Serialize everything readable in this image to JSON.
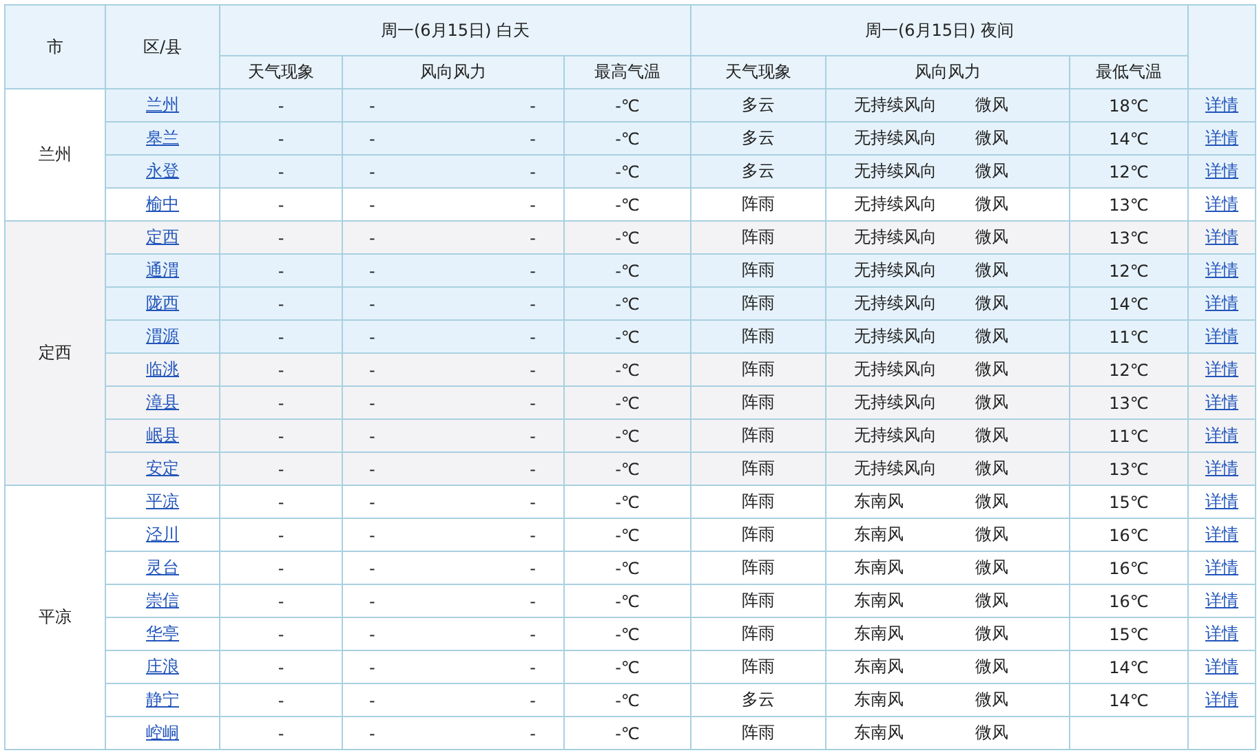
{
  "header": {
    "city": "市",
    "district": "区/县",
    "day_title": "周一(6月15日) 白天",
    "night_title": "周一(6月15日) 夜间",
    "day_columns": [
      "天气现象",
      "风向风力",
      "最高气温"
    ],
    "night_columns": [
      "天气现象",
      "风向风力",
      "最低气温"
    ]
  },
  "cities": [
    {
      "name": "兰州",
      "shaded": false,
      "rows": [
        {
          "district": "兰州",
          "highlighted": true,
          "day_weather": "-",
          "day_wind_direction": "-",
          "day_wind_force": "-",
          "day_high": "-℃",
          "night_weather": "多云",
          "night_wind_direction": "无持续风向",
          "night_wind_force": "微风",
          "night_low": "18℃",
          "details": "详情"
        },
        {
          "district": "皋兰",
          "highlighted": true,
          "day_weather": "-",
          "day_wind_direction": "-",
          "day_wind_force": "-",
          "day_high": "-℃",
          "night_weather": "多云",
          "night_wind_direction": "无持续风向",
          "night_wind_force": "微风",
          "night_low": "14℃",
          "details": "详情"
        },
        {
          "district": "永登",
          "highlighted": true,
          "day_weather": "-",
          "day_wind_direction": "-",
          "day_wind_force": "-",
          "day_high": "-℃",
          "night_weather": "多云",
          "night_wind_direction": "无持续风向",
          "night_wind_force": "微风",
          "night_low": "12℃",
          "details": "详情"
        },
        {
          "district": "榆中",
          "highlighted": false,
          "day_weather": "-",
          "day_wind_direction": "-",
          "day_wind_force": "-",
          "day_high": "-℃",
          "night_weather": "阵雨",
          "night_wind_direction": "无持续风向",
          "night_wind_force": "微风",
          "night_low": "13℃",
          "details": "详情"
        }
      ]
    },
    {
      "name": "定西",
      "shaded": true,
      "rows": [
        {
          "district": "定西",
          "highlighted": false,
          "day_weather": "-",
          "day_wind_direction": "-",
          "day_wind_force": "-",
          "day_high": "-℃",
          "night_weather": "阵雨",
          "night_wind_direction": "无持续风向",
          "night_wind_force": "微风",
          "night_low": "13℃",
          "details": "详情"
        },
        {
          "district": "通渭",
          "highlighted": true,
          "day_weather": "-",
          "day_wind_direction": "-",
          "day_wind_force": "-",
          "day_high": "-℃",
          "night_weather": "阵雨",
          "night_wind_direction": "无持续风向",
          "night_wind_force": "微风",
          "night_low": "12℃",
          "details": "详情"
        },
        {
          "district": "陇西",
          "highlighted": true,
          "day_weather": "-",
          "day_wind_direction": "-",
          "day_wind_force": "-",
          "day_high": "-℃",
          "night_weather": "阵雨",
          "night_wind_direction": "无持续风向",
          "night_wind_force": "微风",
          "night_low": "14℃",
          "details": "详情"
        },
        {
          "district": "渭源",
          "highlighted": true,
          "day_weather": "-",
          "day_wind_direction": "-",
          "day_wind_force": "-",
          "day_high": "-℃",
          "night_weather": "阵雨",
          "night_wind_direction": "无持续风向",
          "night_wind_force": "微风",
          "night_low": "11℃",
          "details": "详情"
        },
        {
          "district": "临洮",
          "highlighted": false,
          "day_weather": "-",
          "day_wind_direction": "-",
          "day_wind_force": "-",
          "day_high": "-℃",
          "night_weather": "阵雨",
          "night_wind_direction": "无持续风向",
          "night_wind_force": "微风",
          "night_low": "12℃",
          "details": "详情"
        },
        {
          "district": "漳县",
          "highlighted": false,
          "day_weather": "-",
          "day_wind_direction": "-",
          "day_wind_force": "-",
          "day_high": "-℃",
          "night_weather": "阵雨",
          "night_wind_direction": "无持续风向",
          "night_wind_force": "微风",
          "night_low": "13℃",
          "details": "详情"
        },
        {
          "district": "岷县",
          "highlighted": false,
          "day_weather": "-",
          "day_wind_direction": "-",
          "day_wind_force": "-",
          "day_high": "-℃",
          "night_weather": "阵雨",
          "night_wind_direction": "无持续风向",
          "night_wind_force": "微风",
          "night_low": "11℃",
          "details": "详情"
        },
        {
          "district": "安定",
          "highlighted": false,
          "day_weather": "-",
          "day_wind_direction": "-",
          "day_wind_force": "-",
          "day_high": "-℃",
          "night_weather": "阵雨",
          "night_wind_direction": "无持续风向",
          "night_wind_force": "微风",
          "night_low": "13℃",
          "details": "详情"
        }
      ]
    },
    {
      "name": "平凉",
      "shaded": false,
      "rows": [
        {
          "district": "平凉",
          "highlighted": false,
          "day_weather": "-",
          "day_wind_direction": "-",
          "day_wind_force": "-",
          "day_high": "-℃",
          "night_weather": "阵雨",
          "night_wind_direction": "东南风",
          "night_wind_force": "微风",
          "night_low": "15℃",
          "details": "详情"
        },
        {
          "district": "泾川",
          "highlighted": false,
          "day_weather": "-",
          "day_wind_direction": "-",
          "day_wind_force": "-",
          "day_high": "-℃",
          "night_weather": "阵雨",
          "night_wind_direction": "东南风",
          "night_wind_force": "微风",
          "night_low": "16℃",
          "details": "详情"
        },
        {
          "district": "灵台",
          "highlighted": false,
          "day_weather": "-",
          "day_wind_direction": "-",
          "day_wind_force": "-",
          "day_high": "-℃",
          "night_weather": "阵雨",
          "night_wind_direction": "东南风",
          "night_wind_force": "微风",
          "night_low": "16℃",
          "details": "详情"
        },
        {
          "district": "崇信",
          "highlighted": false,
          "day_weather": "-",
          "day_wind_direction": "-",
          "day_wind_force": "-",
          "day_high": "-℃",
          "night_weather": "阵雨",
          "night_wind_direction": "东南风",
          "night_wind_force": "微风",
          "night_low": "16℃",
          "details": "详情"
        },
        {
          "district": "华亭",
          "highlighted": false,
          "day_weather": "-",
          "day_wind_direction": "-",
          "day_wind_force": "-",
          "day_high": "-℃",
          "night_weather": "阵雨",
          "night_wind_direction": "东南风",
          "night_wind_force": "微风",
          "night_low": "15℃",
          "details": "详情"
        },
        {
          "district": "庄浪",
          "highlighted": false,
          "day_weather": "-",
          "day_wind_direction": "-",
          "day_wind_force": "-",
          "day_high": "-℃",
          "night_weather": "阵雨",
          "night_wind_direction": "东南风",
          "night_wind_force": "微风",
          "night_low": "14℃",
          "details": "详情"
        },
        {
          "district": "静宁",
          "highlighted": false,
          "day_weather": "-",
          "day_wind_direction": "-",
          "day_wind_force": "-",
          "day_high": "-℃",
          "night_weather": "多云",
          "night_wind_direction": "东南风",
          "night_wind_force": "微风",
          "night_low": "14℃",
          "details": "详情"
        },
        {
          "district": "崆峒",
          "highlighted": false,
          "day_weather": "-",
          "day_wind_direction": "-",
          "day_wind_force": "-",
          "day_high": "-℃",
          "night_weather": "阵雨",
          "night_wind_direction": "东南风",
          "night_wind_force": "微风"
        }
      ]
    }
  ]
}
